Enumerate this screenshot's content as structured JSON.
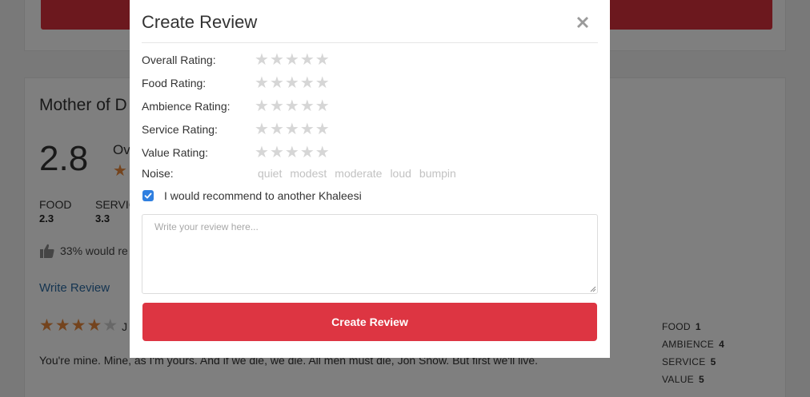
{
  "background": {
    "restaurant_name": "Mother of D",
    "overall_score": "2.8",
    "overall_label_peek": "Ov",
    "categories": [
      {
        "label": "FOOD",
        "value": "2.3"
      },
      {
        "label": "SERVIC",
        "value": "3.3"
      }
    ],
    "recommend_text": "33% would re",
    "write_review_link": "Write Review",
    "review": {
      "stars_filled": 4,
      "stars_total": 5,
      "author_initial": "J",
      "text": "You're mine. Mine, as I'm yours. And if we die, we die. All men must die, Jon Snow. But first we'll live.",
      "breakdown": [
        {
          "label": "FOOD",
          "value": "1"
        },
        {
          "label": "AMBIENCE",
          "value": "4"
        },
        {
          "label": "SERVICE",
          "value": "5"
        },
        {
          "label": "VALUE",
          "value": "5"
        }
      ]
    },
    "colors": {
      "accent_red": "#d9303d",
      "star_orange": "#e8893c",
      "link_blue": "#2b6aa3"
    }
  },
  "modal": {
    "title": "Create Review",
    "close_icon": "close-icon",
    "ratings": [
      {
        "label": "Overall Rating:",
        "value": 0,
        "max": 5
      },
      {
        "label": "Food Rating:",
        "value": 0,
        "max": 5
      },
      {
        "label": "Ambience Rating:",
        "value": 0,
        "max": 5
      },
      {
        "label": "Service Rating:",
        "value": 0,
        "max": 5
      },
      {
        "label": "Value Rating:",
        "value": 0,
        "max": 5
      }
    ],
    "noise": {
      "label": "Noise:",
      "options": [
        "quiet",
        "modest",
        "moderate",
        "loud",
        "bumpin"
      ]
    },
    "recommend": {
      "checked": true,
      "label": "I would recommend to another Khaleesi"
    },
    "review_input": {
      "placeholder": "Write your review here...",
      "value": ""
    },
    "submit_label": "Create Review",
    "colors": {
      "submit_bg": "#dd3542",
      "checkbox": "#2f7fe0",
      "star_empty": "#d6d6d6"
    }
  }
}
